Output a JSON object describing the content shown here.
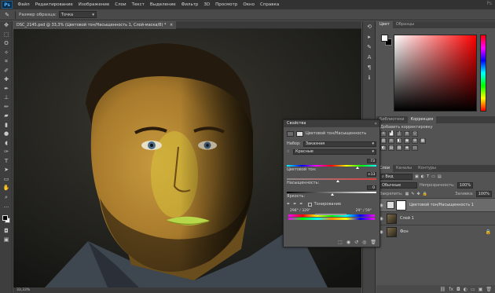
{
  "app": {
    "logo": "Ps"
  },
  "menu": [
    "Файл",
    "Редактирование",
    "Изображение",
    "Слои",
    "Текст",
    "Выделение",
    "Фильтр",
    "3D",
    "Просмотр",
    "Окно",
    "Справка"
  ],
  "options": {
    "sample_label": "Размер образца:",
    "sample_value": "Точка"
  },
  "document": {
    "tab_title": "DSC_2145.psd @ 33,3% (Цветовой тон/Насыщенность 1, Слой-маска/8) *",
    "close": "×",
    "zoom": "33,33%"
  },
  "color_panel": {
    "tabs": [
      "Цвет",
      "Образцы"
    ],
    "active_tab": "Цвет"
  },
  "adjust_panel": {
    "tabs": [
      "Библиотеки",
      "Коррекция"
    ],
    "active_tab": "Коррекция",
    "subtitle": "Добавить корректировку"
  },
  "layers_panel": {
    "tabs": [
      "Слои",
      "Каналы",
      "Контуры"
    ],
    "active_tab": "Слои",
    "filter_label": "Вид",
    "blend_mode": "Обычные",
    "opacity_label": "Непрозрачность:",
    "opacity_value": "100%",
    "lock_label": "Закрепить:",
    "fill_label": "Заливка:",
    "fill_value": "100%",
    "layers": [
      {
        "name": "Цветовой тон/Насыщенность 1",
        "selected": true
      },
      {
        "name": "Слой 1",
        "selected": false
      },
      {
        "name": "Фон",
        "selected": false,
        "locked": true
      }
    ]
  },
  "properties_panel": {
    "title": "Свойства",
    "adjustment_name": "Цветовой тон/Насыщенность",
    "preset_label": "Набор:",
    "preset_value": "Заказная",
    "channel_value": "Красные",
    "hue_label": "Цветовой тон:",
    "hue_value": "73",
    "saturation_label": "Насыщенность:",
    "saturation_value": "+13",
    "lightness_label": "Яркость:",
    "lightness_value": "0",
    "colorize_label": "Тонирование",
    "range_left": "298° / 329°",
    "range_right": "29° / 59°",
    "hue_pos": 0.78,
    "sat_pos": 0.56,
    "light_pos": 0.5
  }
}
